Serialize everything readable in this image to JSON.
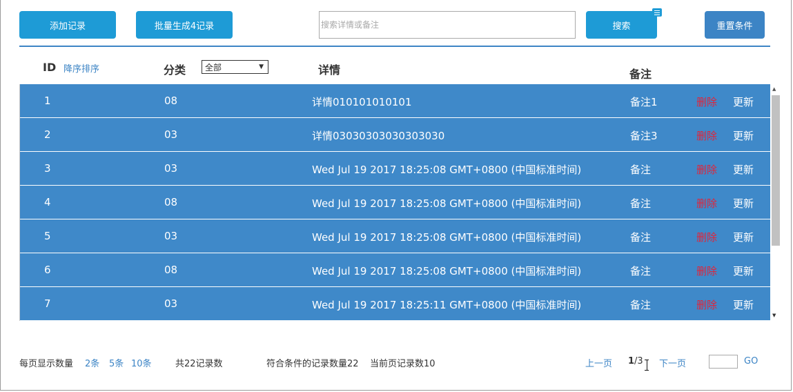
{
  "toolbar": {
    "add_label": "添加记录",
    "batch_label": "批量生成4记录",
    "search_placeholder": "搜索详情或备注",
    "search_value": "",
    "search_label": "搜索",
    "reset_label": "重置条件"
  },
  "header": {
    "id": "ID",
    "sort": "降序排序",
    "category": "分类",
    "category_select": "全部",
    "detail": "详情",
    "note": "备注"
  },
  "rows": [
    {
      "id": "1",
      "category": "08",
      "detail": "详情010101010101",
      "note": "备注1",
      "delete": "删除",
      "update": "更新"
    },
    {
      "id": "2",
      "category": "03",
      "detail": "详情03030303030303030",
      "note": "备注3",
      "delete": "删除",
      "update": "更新"
    },
    {
      "id": "3",
      "category": "03",
      "detail": "Wed Jul 19 2017 18:25:08 GMT+0800 (中国标准时间)",
      "note": "备注",
      "delete": "删除",
      "update": "更新"
    },
    {
      "id": "4",
      "category": "08",
      "detail": "Wed Jul 19 2017 18:25:08 GMT+0800 (中国标准时间)",
      "note": "备注",
      "delete": "删除",
      "update": "更新"
    },
    {
      "id": "5",
      "category": "03",
      "detail": "Wed Jul 19 2017 18:25:08 GMT+0800 (中国标准时间)",
      "note": "备注",
      "delete": "删除",
      "update": "更新"
    },
    {
      "id": "6",
      "category": "08",
      "detail": "Wed Jul 19 2017 18:25:08 GMT+0800 (中国标准时间)",
      "note": "备注",
      "delete": "删除",
      "update": "更新"
    },
    {
      "id": "7",
      "category": "03",
      "detail": "Wed Jul 19 2017 18:25:11 GMT+0800 (中国标准时间)",
      "note": "备注",
      "delete": "删除",
      "update": "更新"
    }
  ],
  "footer": {
    "per_page_label": "每页显示数量",
    "per_page_options": [
      "2条",
      "5条",
      "10条"
    ],
    "total": "共22记录数",
    "matched": "符合条件的记录数量22",
    "current": "当前页记录数10",
    "prev": "上一页",
    "page_current": "1",
    "page_total": "/3",
    "next": "下一页",
    "go_value": "",
    "go": "GO"
  },
  "colors": {
    "button": "#1e9bd6",
    "reset_button": "#3c84c5",
    "row": "#3f89c9",
    "delete": "#e0243a",
    "link": "#3c84c5"
  }
}
